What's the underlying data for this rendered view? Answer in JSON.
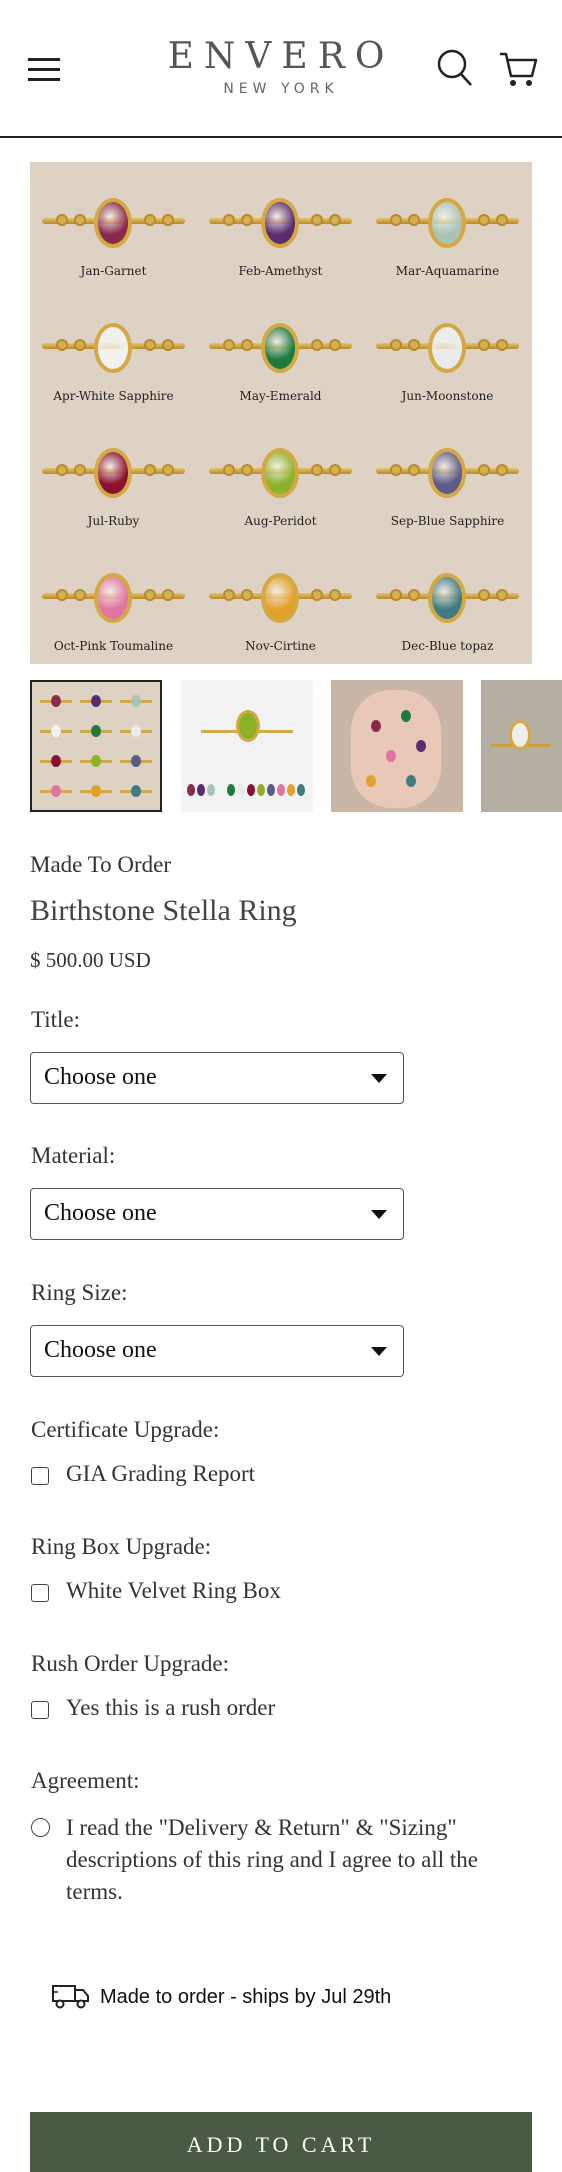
{
  "header": {
    "brand": "ENVERO",
    "city": "NEW YORK",
    "menu_icon": "hamburger-menu-icon",
    "search_icon": "search-icon",
    "cart_icon": "cart-icon"
  },
  "gallery": {
    "stones": [
      {
        "label": "Jan-Garnet",
        "color": "#8a2a4a"
      },
      {
        "label": "Feb-Amethyst",
        "color": "#5b2c6e"
      },
      {
        "label": "Mar-Aquamarine",
        "color": "#a9c4b6"
      },
      {
        "label": "Apr-White Sapphire",
        "color": "#f2f2f2"
      },
      {
        "label": "May-Emerald",
        "color": "#1f7a3e"
      },
      {
        "label": "Jun-Moonstone",
        "color": "#e8ecef"
      },
      {
        "label": "Jul-Ruby",
        "color": "#8b1030"
      },
      {
        "label": "Aug-Peridot",
        "color": "#8cb22a"
      },
      {
        "label": "Sep-Blue Sapphire",
        "color": "#5c5a86"
      },
      {
        "label": "Oct-Pink Toumaline",
        "color": "#e074a2"
      },
      {
        "label": "Nov-Cirtine",
        "color": "#e3a12a"
      },
      {
        "label": "Dec-Blue topaz",
        "color": "#3f7b82"
      }
    ],
    "thumbnail_count": 4
  },
  "product": {
    "availability": "Made To Order",
    "title": "Birthstone Stella Ring",
    "price": "$ 500.00 USD"
  },
  "options": {
    "title": {
      "label": "Title:",
      "value": "Choose one"
    },
    "material": {
      "label": "Material:",
      "value": "Choose one"
    },
    "ring_size": {
      "label": "Ring Size:",
      "value": "Choose one"
    }
  },
  "upgrades": {
    "certificate": {
      "label": "Certificate Upgrade:",
      "option": "GIA Grading Report",
      "checked": false
    },
    "ring_box": {
      "label": "Ring Box Upgrade:",
      "option": "White Velvet Ring Box",
      "checked": false
    },
    "rush": {
      "label": "Rush Order Upgrade:",
      "option": "Yes this is a rush order",
      "checked": false
    }
  },
  "agreement": {
    "label": "Agreement:",
    "text": "I read the \"Delivery & Return\" & \"Sizing\" descriptions of this ring and I agree to all the terms."
  },
  "shipping": {
    "icon": "delivery-truck-icon",
    "text": "Made to order - ships by Jul 29th"
  },
  "cta": {
    "add_to_cart": "ADD TO CART"
  },
  "colors": {
    "accent": "#4a5a44",
    "hero_background": "#ddd2c4"
  }
}
